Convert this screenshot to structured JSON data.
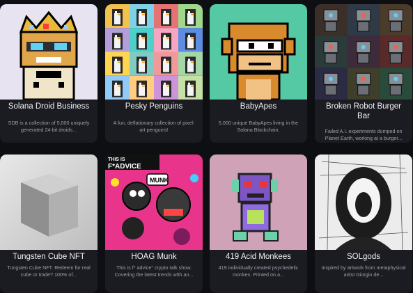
{
  "collections": [
    {
      "title": "Solana Droid Business",
      "description": "SDB is a collection of 5,000 uniquely generated 24-bit droids...",
      "art": "pixel-crowned-droid",
      "bg": "#e7e3f0"
    },
    {
      "title": "Pesky Penguins",
      "description": "A fun, deflationary collection of pixel-art penguins!",
      "art": "penguin-grid",
      "bg": "#6b6cc9"
    },
    {
      "title": "BabyApes",
      "description": "5,000 unique BabyApes living in the Solana Blockchain.",
      "art": "pixel-ape",
      "bg": "#54c9a4"
    },
    {
      "title": "Broken Robot Burger Bar",
      "description": "Failed A.I. experiments dumped on Planet Earth, working at a burger...",
      "art": "robot-grid",
      "bg": "#2c2c30"
    },
    {
      "title": "Tungsten Cube NFT",
      "description": "Tungsten Cube NFT. Redeem for real cube or trade? 100% of...",
      "art": "metal-cube",
      "bg": "#d9d9d9"
    },
    {
      "title": "HOAG Munk",
      "description": "This is f* advice\" crypto talk show. Covering the latest trends with an...",
      "art": "comic-cover",
      "bg": "#e8348a",
      "cover_text": "THIS IS",
      "cover_text2": "F*ADVICE",
      "speech": "MUNK"
    },
    {
      "title": "419 Acid Monkees",
      "description": "419 individually created psychedelic monkes. Printed on a...",
      "art": "acid-monkey",
      "bg": "#cfa2b8"
    },
    {
      "title": "SOLgods",
      "description": "Inspired by artwork from metaphysical artist Giorgio de...",
      "art": "sketch-face",
      "bg": "#ececec"
    }
  ]
}
